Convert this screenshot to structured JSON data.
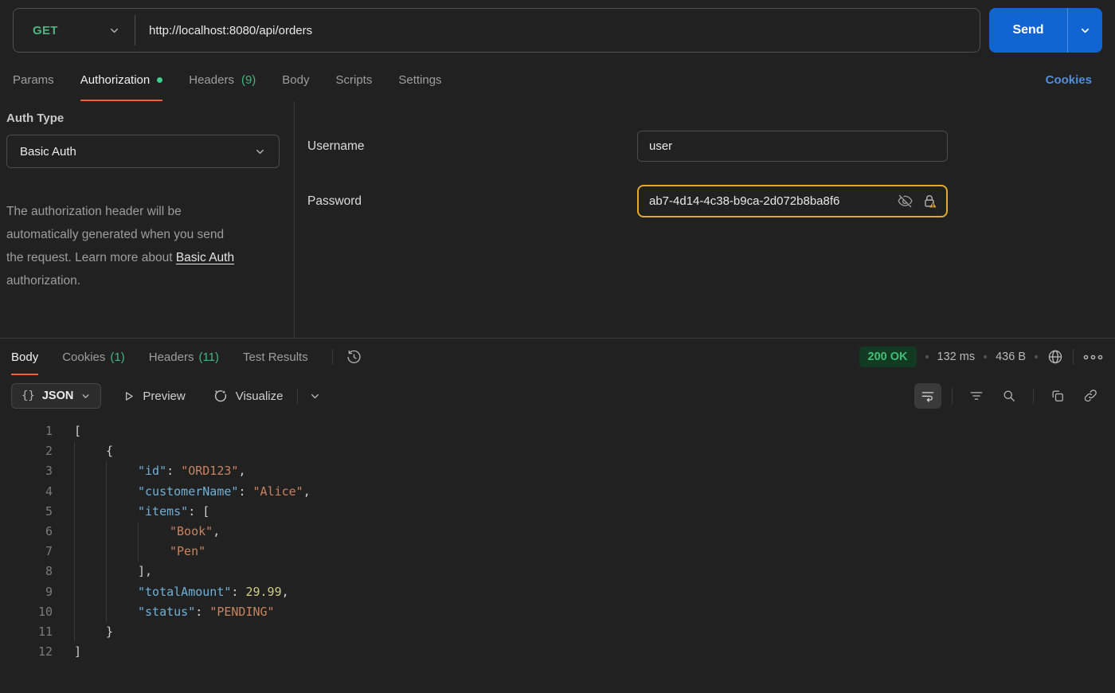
{
  "request": {
    "method": "GET",
    "url": "http://localhost:8080/api/orders",
    "send_label": "Send",
    "tabs": {
      "params": "Params",
      "authorization": "Authorization",
      "headers": "Headers",
      "headers_count": "(9)",
      "body": "Body",
      "scripts": "Scripts",
      "settings": "Settings"
    },
    "cookies_link": "Cookies"
  },
  "auth": {
    "type_label": "Auth Type",
    "type_value": "Basic Auth",
    "info_line1": "The authorization header will be",
    "info_line2": "automatically generated when you send",
    "info_line3_prefix": "the request. Learn more about ",
    "info_link": "Basic Auth",
    "info_line4": "authorization.",
    "username_label": "Username",
    "username_value": "user",
    "password_label": "Password",
    "password_value": "ab7-4d14-4c38-b9ca-2d072b8ba8f6"
  },
  "response": {
    "tabs": {
      "body": "Body",
      "cookies": "Cookies",
      "cookies_count": "(1)",
      "headers": "Headers",
      "headers_count": "(11)",
      "test_results": "Test Results"
    },
    "status": "200 OK",
    "time": "132 ms",
    "size": "436 B",
    "toolbar": {
      "braces": "{}",
      "format_label": "JSON",
      "preview_label": "Preview",
      "visualize_label": "Visualize"
    },
    "body_lines": [
      {
        "n": 1,
        "indent": 0,
        "tokens": [
          {
            "t": "[",
            "c": "p"
          }
        ]
      },
      {
        "n": 2,
        "indent": 1,
        "tokens": [
          {
            "t": "{",
            "c": "p"
          }
        ]
      },
      {
        "n": 3,
        "indent": 2,
        "tokens": [
          {
            "t": "\"id\"",
            "c": "k"
          },
          {
            "t": ": ",
            "c": "p"
          },
          {
            "t": "\"ORD123\"",
            "c": "s"
          },
          {
            "t": ",",
            "c": "p"
          }
        ]
      },
      {
        "n": 4,
        "indent": 2,
        "tokens": [
          {
            "t": "\"customerName\"",
            "c": "k"
          },
          {
            "t": ": ",
            "c": "p"
          },
          {
            "t": "\"Alice\"",
            "c": "s"
          },
          {
            "t": ",",
            "c": "p"
          }
        ]
      },
      {
        "n": 5,
        "indent": 2,
        "tokens": [
          {
            "t": "\"items\"",
            "c": "k"
          },
          {
            "t": ": ",
            "c": "p"
          },
          {
            "t": "[",
            "c": "p"
          }
        ]
      },
      {
        "n": 6,
        "indent": 3,
        "tokens": [
          {
            "t": "\"Book\"",
            "c": "s"
          },
          {
            "t": ",",
            "c": "p"
          }
        ]
      },
      {
        "n": 7,
        "indent": 3,
        "tokens": [
          {
            "t": "\"Pen\"",
            "c": "s"
          }
        ]
      },
      {
        "n": 8,
        "indent": 2,
        "tokens": [
          {
            "t": "],",
            "c": "p"
          }
        ]
      },
      {
        "n": 9,
        "indent": 2,
        "tokens": [
          {
            "t": "\"totalAmount\"",
            "c": "k"
          },
          {
            "t": ": ",
            "c": "p"
          },
          {
            "t": "29.99",
            "c": "n"
          },
          {
            "t": ",",
            "c": "p"
          }
        ]
      },
      {
        "n": 10,
        "indent": 2,
        "tokens": [
          {
            "t": "\"status\"",
            "c": "k"
          },
          {
            "t": ": ",
            "c": "p"
          },
          {
            "t": "\"PENDING\"",
            "c": "s"
          }
        ]
      },
      {
        "n": 11,
        "indent": 1,
        "tokens": [
          {
            "t": "}",
            "c": "p"
          }
        ]
      },
      {
        "n": 12,
        "indent": 0,
        "tokens": [
          {
            "t": "]",
            "c": "p"
          }
        ]
      }
    ]
  }
}
